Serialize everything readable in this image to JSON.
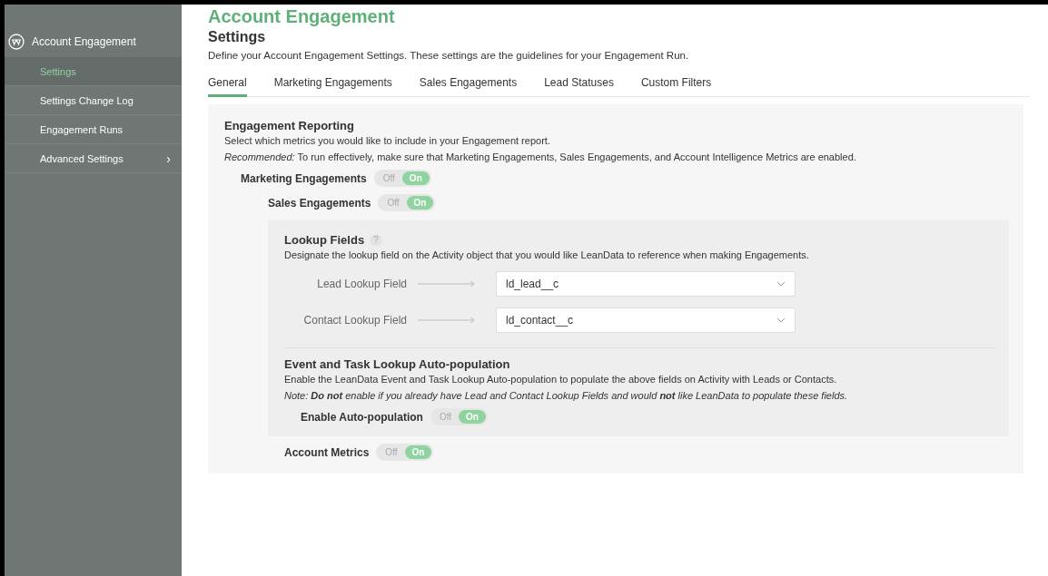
{
  "sidebar": {
    "title": "Account Engagement",
    "items": [
      {
        "label": "Settings",
        "selected": true
      },
      {
        "label": "Settings Change Log",
        "selected": false
      },
      {
        "label": "Engagement Runs",
        "selected": false
      },
      {
        "label": "Advanced Settings",
        "selected": false,
        "submenu_glyph": "›"
      }
    ]
  },
  "header": {
    "title": "Account Engagement",
    "subtitle": "Settings",
    "description": "Define your Account Engagement Settings. These settings are the guidelines for your Engagement Run."
  },
  "tabs": [
    {
      "label": "General",
      "selected": true
    },
    {
      "label": "Marketing Engagements",
      "selected": false
    },
    {
      "label": "Sales Engagements",
      "selected": false
    },
    {
      "label": "Lead Statuses",
      "selected": false
    },
    {
      "label": "Custom Filters",
      "selected": false
    }
  ],
  "reporting": {
    "title": "Engagement Reporting",
    "description": "Select which metrics you would like to include in your Engagement report.",
    "recommendation": "*Recommended:* To run effectively, make sure that Marketing Engagements, Sales Engagements, and Account Intelligence Metrics are enabled.",
    "toggles": [
      {
        "label": "Marketing Engagements",
        "off_label": "Off",
        "on_label": "On",
        "on": true
      },
      {
        "label": "Sales Engagements",
        "off_label": "Off",
        "on_label": "On",
        "on": true
      }
    ]
  },
  "lookup": {
    "title": "Lookup Fields",
    "help": "?",
    "description": "Designate the lookup field on the Activity object that you would like LeanData to reference when making Engagements.",
    "fields": [
      {
        "label": "Lead Lookup Field",
        "value": "ld_lead__c"
      },
      {
        "label": "Contact Lookup Field",
        "value": "ld_contact__c"
      }
    ]
  },
  "autopop": {
    "title": "Event and Task Lookup Auto-population",
    "description": "Enable the LeanData Event and Task Lookup Auto-population to populate the above fields on Activity with Leads or Contacts.",
    "note": "Note: **Do not** enable if you already have Lead and Contact Lookup Fields and would **not** like LeanData to populate these fields.",
    "toggle": {
      "label": "Enable Auto-population",
      "off_label": "Off",
      "on_label": "On",
      "on": true
    }
  },
  "account_metrics": {
    "label": "Account Metrics",
    "off_label": "Off",
    "on_label": "On",
    "on": true
  }
}
